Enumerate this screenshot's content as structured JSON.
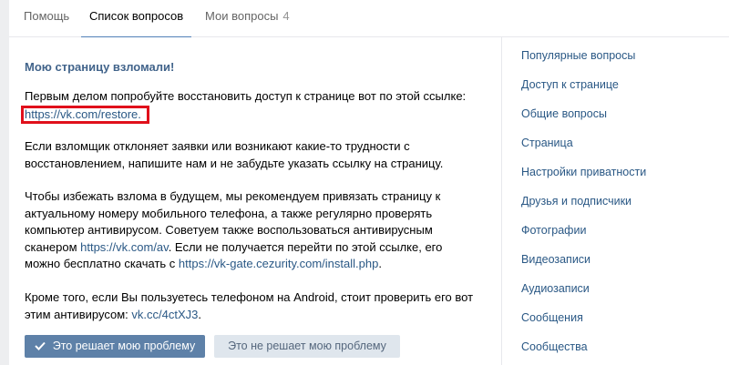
{
  "tabs": [
    {
      "label": "Помощь"
    },
    {
      "label": "Список вопросов"
    },
    {
      "label": "Мои вопросы",
      "count": "4"
    }
  ],
  "article": {
    "title": "Мою страницу взломали!",
    "p1": "Первым делом попробуйте восстановить доступ к странице вот по этой ссылке:",
    "p1_link": "https://vk.com/restore.",
    "p2_line1": "Если взломщик отклоняет заявки или возникают какие-то трудности с",
    "p2_line2": "восстановлением, напишите нам и не забудьте указать ссылку на страницу.",
    "p3_line1": "Чтобы избежать взлома в будущем, мы рекомендуем привязать страницу к",
    "p3_line2": "актуальному номеру мобильного телефона, а также регулярно проверять",
    "p3_line3": "компьютер антивирусом. Советуем также воспользоваться антивирусным",
    "p3_line4_pre": "сканером ",
    "p3_link1": "https://vk.com/av",
    "p3_line4_post": ". Если не получается перейти по этой ссылке, его",
    "p3_line5_pre": "можно бесплатно скачать с ",
    "p3_link2": "https://vk-gate.cezurity.com/install.php",
    "p3_line5_post": ".",
    "p4_line1": "Кроме того, если Вы пользуетесь телефоном на Android, стоит проверить его вот",
    "p4_line2_pre": "этим антивирусом: ",
    "p4_link": "vk.cc/4ctXJ3",
    "p4_line2_post": "."
  },
  "buttons": {
    "solves": "Это решает мою проблему",
    "not_solves": "Это не решает мою проблему"
  },
  "sidebar": {
    "items": [
      {
        "label": "Популярные вопросы"
      },
      {
        "label": "Доступ к странице"
      },
      {
        "label": "Общие вопросы"
      },
      {
        "label": "Страница"
      },
      {
        "label": "Настройки приватности"
      },
      {
        "label": "Друзья и подписчики"
      },
      {
        "label": "Фотографии"
      },
      {
        "label": "Видеозаписи"
      },
      {
        "label": "Аудиозаписи"
      },
      {
        "label": "Сообщения"
      },
      {
        "label": "Сообщества"
      }
    ]
  },
  "colors": {
    "accent": "#5181b8",
    "link": "#2a5885",
    "title": "#42648b",
    "highlight_box": "#e0101b"
  }
}
